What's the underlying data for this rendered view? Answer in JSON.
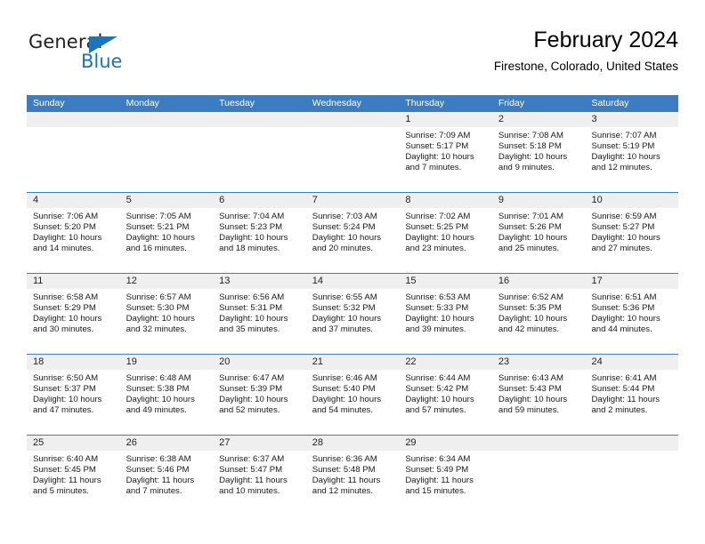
{
  "brand": {
    "name_part1": "General",
    "name_part2": "Blue",
    "triangle_icon": "blue-triangle-icon",
    "color_dark": "#231f20",
    "color_blue": "#1b75bb"
  },
  "header": {
    "month_title": "February 2024",
    "location": "Firestone, Colorado, United States"
  },
  "theme": {
    "header_band": "#3b7dc0",
    "date_band": "#efefef",
    "cell_bg": "#ffffff",
    "row_divider": "#3b7dc0"
  },
  "calendar": {
    "weekdays": [
      "Sunday",
      "Monday",
      "Tuesday",
      "Wednesday",
      "Thursday",
      "Friday",
      "Saturday"
    ],
    "weeks": [
      [
        {
          "day": ""
        },
        {
          "day": ""
        },
        {
          "day": ""
        },
        {
          "day": ""
        },
        {
          "day": "1",
          "sunrise": "Sunrise: 7:09 AM",
          "sunset": "Sunset: 5:17 PM",
          "daylight": "Daylight: 10 hours and 7 minutes."
        },
        {
          "day": "2",
          "sunrise": "Sunrise: 7:08 AM",
          "sunset": "Sunset: 5:18 PM",
          "daylight": "Daylight: 10 hours and 9 minutes."
        },
        {
          "day": "3",
          "sunrise": "Sunrise: 7:07 AM",
          "sunset": "Sunset: 5:19 PM",
          "daylight": "Daylight: 10 hours and 12 minutes."
        }
      ],
      [
        {
          "day": "4",
          "sunrise": "Sunrise: 7:06 AM",
          "sunset": "Sunset: 5:20 PM",
          "daylight": "Daylight: 10 hours and 14 minutes."
        },
        {
          "day": "5",
          "sunrise": "Sunrise: 7:05 AM",
          "sunset": "Sunset: 5:21 PM",
          "daylight": "Daylight: 10 hours and 16 minutes."
        },
        {
          "day": "6",
          "sunrise": "Sunrise: 7:04 AM",
          "sunset": "Sunset: 5:23 PM",
          "daylight": "Daylight: 10 hours and 18 minutes."
        },
        {
          "day": "7",
          "sunrise": "Sunrise: 7:03 AM",
          "sunset": "Sunset: 5:24 PM",
          "daylight": "Daylight: 10 hours and 20 minutes."
        },
        {
          "day": "8",
          "sunrise": "Sunrise: 7:02 AM",
          "sunset": "Sunset: 5:25 PM",
          "daylight": "Daylight: 10 hours and 23 minutes."
        },
        {
          "day": "9",
          "sunrise": "Sunrise: 7:01 AM",
          "sunset": "Sunset: 5:26 PM",
          "daylight": "Daylight: 10 hours and 25 minutes."
        },
        {
          "day": "10",
          "sunrise": "Sunrise: 6:59 AM",
          "sunset": "Sunset: 5:27 PM",
          "daylight": "Daylight: 10 hours and 27 minutes."
        }
      ],
      [
        {
          "day": "11",
          "sunrise": "Sunrise: 6:58 AM",
          "sunset": "Sunset: 5:29 PM",
          "daylight": "Daylight: 10 hours and 30 minutes."
        },
        {
          "day": "12",
          "sunrise": "Sunrise: 6:57 AM",
          "sunset": "Sunset: 5:30 PM",
          "daylight": "Daylight: 10 hours and 32 minutes."
        },
        {
          "day": "13",
          "sunrise": "Sunrise: 6:56 AM",
          "sunset": "Sunset: 5:31 PM",
          "daylight": "Daylight: 10 hours and 35 minutes."
        },
        {
          "day": "14",
          "sunrise": "Sunrise: 6:55 AM",
          "sunset": "Sunset: 5:32 PM",
          "daylight": "Daylight: 10 hours and 37 minutes."
        },
        {
          "day": "15",
          "sunrise": "Sunrise: 6:53 AM",
          "sunset": "Sunset: 5:33 PM",
          "daylight": "Daylight: 10 hours and 39 minutes."
        },
        {
          "day": "16",
          "sunrise": "Sunrise: 6:52 AM",
          "sunset": "Sunset: 5:35 PM",
          "daylight": "Daylight: 10 hours and 42 minutes."
        },
        {
          "day": "17",
          "sunrise": "Sunrise: 6:51 AM",
          "sunset": "Sunset: 5:36 PM",
          "daylight": "Daylight: 10 hours and 44 minutes."
        }
      ],
      [
        {
          "day": "18",
          "sunrise": "Sunrise: 6:50 AM",
          "sunset": "Sunset: 5:37 PM",
          "daylight": "Daylight: 10 hours and 47 minutes."
        },
        {
          "day": "19",
          "sunrise": "Sunrise: 6:48 AM",
          "sunset": "Sunset: 5:38 PM",
          "daylight": "Daylight: 10 hours and 49 minutes."
        },
        {
          "day": "20",
          "sunrise": "Sunrise: 6:47 AM",
          "sunset": "Sunset: 5:39 PM",
          "daylight": "Daylight: 10 hours and 52 minutes."
        },
        {
          "day": "21",
          "sunrise": "Sunrise: 6:46 AM",
          "sunset": "Sunset: 5:40 PM",
          "daylight": "Daylight: 10 hours and 54 minutes."
        },
        {
          "day": "22",
          "sunrise": "Sunrise: 6:44 AM",
          "sunset": "Sunset: 5:42 PM",
          "daylight": "Daylight: 10 hours and 57 minutes."
        },
        {
          "day": "23",
          "sunrise": "Sunrise: 6:43 AM",
          "sunset": "Sunset: 5:43 PM",
          "daylight": "Daylight: 10 hours and 59 minutes."
        },
        {
          "day": "24",
          "sunrise": "Sunrise: 6:41 AM",
          "sunset": "Sunset: 5:44 PM",
          "daylight": "Daylight: 11 hours and 2 minutes."
        }
      ],
      [
        {
          "day": "25",
          "sunrise": "Sunrise: 6:40 AM",
          "sunset": "Sunset: 5:45 PM",
          "daylight": "Daylight: 11 hours and 5 minutes."
        },
        {
          "day": "26",
          "sunrise": "Sunrise: 6:38 AM",
          "sunset": "Sunset: 5:46 PM",
          "daylight": "Daylight: 11 hours and 7 minutes."
        },
        {
          "day": "27",
          "sunrise": "Sunrise: 6:37 AM",
          "sunset": "Sunset: 5:47 PM",
          "daylight": "Daylight: 11 hours and 10 minutes."
        },
        {
          "day": "28",
          "sunrise": "Sunrise: 6:36 AM",
          "sunset": "Sunset: 5:48 PM",
          "daylight": "Daylight: 11 hours and 12 minutes."
        },
        {
          "day": "29",
          "sunrise": "Sunrise: 6:34 AM",
          "sunset": "Sunset: 5:49 PM",
          "daylight": "Daylight: 11 hours and 15 minutes."
        },
        {
          "day": ""
        },
        {
          "day": ""
        }
      ]
    ]
  }
}
